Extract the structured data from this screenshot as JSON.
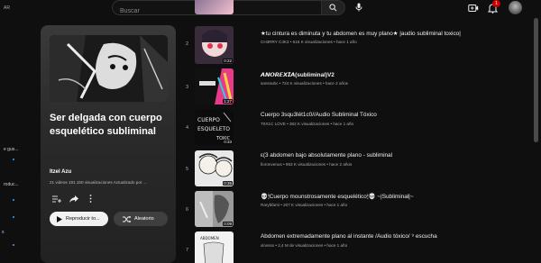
{
  "topbar": {
    "country": "AR",
    "search_placeholder": "Buscar",
    "notification_count": "1"
  },
  "sidebar": {
    "items": [
      "e gus...",
      "roduc..."
    ]
  },
  "playlist": {
    "title": "Ser delgada con cuerpo esquelético subliminal",
    "owner": "Itzel Azu",
    "stats": "21 videos   191.150 visualizaciones   Actualizado por ...",
    "play_label": "Reproducir to...",
    "shuffle_label": "Aleatorio"
  },
  "videos": [
    {
      "index": "2",
      "title": "★tu cintura es diminuta y tu abdomen es muy plano★ |audio subliminal toxico|",
      "meta": "CH3RRY C4K3 • 616 K visualizaciones • hace 1 año",
      "duration": "0:22"
    },
    {
      "index": "3",
      "title": "𝘼𝙉𝙊𝙍𝙀𝙓𝙄𝘼(subliminal)V2",
      "meta": "sanssubc • 724 K visualizaciones • hace 2 años",
      "duration": "1:27"
    },
    {
      "index": "4",
      "title": "Cuerpo 3squ3lét1c0//Audio Subliminal Tóxico",
      "meta": "T0X1C LOVE • 362 K visualizaciones • hace 1 año",
      "duration": "0:33"
    },
    {
      "index": "5",
      "title": "ε(3 abdomen bajo absolutamente plano - subliminal",
      "meta": "fioronvenus • 953 K visualizaciones • hace 2 años",
      "duration": "0:36"
    },
    {
      "index": "6",
      "title": "💀🕯Cuerpo mounstrosamente esquelético🕯💀 ~|Subliminal|~",
      "meta": "Rarybfami • 207 K visualizaciones • hace 1 año",
      "duration": "0:09"
    },
    {
      "index": "7",
      "title": "Abdomen extremadamente plano al instante /Audio tóxico/ ⁹ escucha",
      "meta": "xlovssx • 2,4 M de visualizaciones • hace 1 año",
      "duration": ""
    }
  ],
  "colors": {
    "background": "#0f0f0f",
    "accent": "#3ea6ff",
    "badge": "#cc0000"
  }
}
